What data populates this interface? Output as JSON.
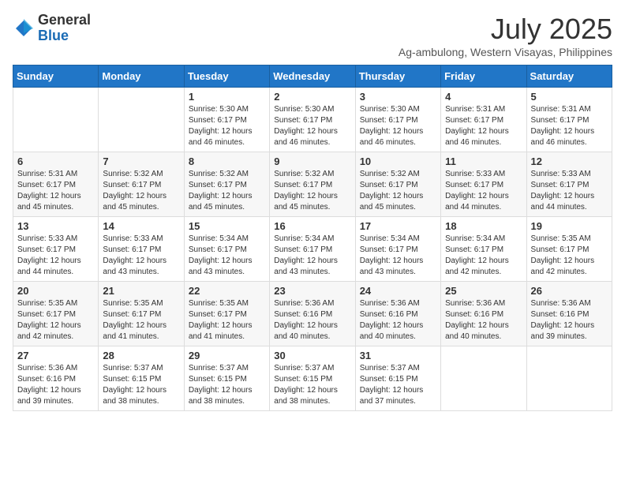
{
  "logo": {
    "general": "General",
    "blue": "Blue"
  },
  "title": "July 2025",
  "location": "Ag-ambulong, Western Visayas, Philippines",
  "weekdays": [
    "Sunday",
    "Monday",
    "Tuesday",
    "Wednesday",
    "Thursday",
    "Friday",
    "Saturday"
  ],
  "weeks": [
    [
      {
        "day": "",
        "info": ""
      },
      {
        "day": "",
        "info": ""
      },
      {
        "day": "1",
        "info": "Sunrise: 5:30 AM\nSunset: 6:17 PM\nDaylight: 12 hours and 46 minutes."
      },
      {
        "day": "2",
        "info": "Sunrise: 5:30 AM\nSunset: 6:17 PM\nDaylight: 12 hours and 46 minutes."
      },
      {
        "day": "3",
        "info": "Sunrise: 5:30 AM\nSunset: 6:17 PM\nDaylight: 12 hours and 46 minutes."
      },
      {
        "day": "4",
        "info": "Sunrise: 5:31 AM\nSunset: 6:17 PM\nDaylight: 12 hours and 46 minutes."
      },
      {
        "day": "5",
        "info": "Sunrise: 5:31 AM\nSunset: 6:17 PM\nDaylight: 12 hours and 46 minutes."
      }
    ],
    [
      {
        "day": "6",
        "info": "Sunrise: 5:31 AM\nSunset: 6:17 PM\nDaylight: 12 hours and 45 minutes."
      },
      {
        "day": "7",
        "info": "Sunrise: 5:32 AM\nSunset: 6:17 PM\nDaylight: 12 hours and 45 minutes."
      },
      {
        "day": "8",
        "info": "Sunrise: 5:32 AM\nSunset: 6:17 PM\nDaylight: 12 hours and 45 minutes."
      },
      {
        "day": "9",
        "info": "Sunrise: 5:32 AM\nSunset: 6:17 PM\nDaylight: 12 hours and 45 minutes."
      },
      {
        "day": "10",
        "info": "Sunrise: 5:32 AM\nSunset: 6:17 PM\nDaylight: 12 hours and 45 minutes."
      },
      {
        "day": "11",
        "info": "Sunrise: 5:33 AM\nSunset: 6:17 PM\nDaylight: 12 hours and 44 minutes."
      },
      {
        "day": "12",
        "info": "Sunrise: 5:33 AM\nSunset: 6:17 PM\nDaylight: 12 hours and 44 minutes."
      }
    ],
    [
      {
        "day": "13",
        "info": "Sunrise: 5:33 AM\nSunset: 6:17 PM\nDaylight: 12 hours and 44 minutes."
      },
      {
        "day": "14",
        "info": "Sunrise: 5:33 AM\nSunset: 6:17 PM\nDaylight: 12 hours and 43 minutes."
      },
      {
        "day": "15",
        "info": "Sunrise: 5:34 AM\nSunset: 6:17 PM\nDaylight: 12 hours and 43 minutes."
      },
      {
        "day": "16",
        "info": "Sunrise: 5:34 AM\nSunset: 6:17 PM\nDaylight: 12 hours and 43 minutes."
      },
      {
        "day": "17",
        "info": "Sunrise: 5:34 AM\nSunset: 6:17 PM\nDaylight: 12 hours and 43 minutes."
      },
      {
        "day": "18",
        "info": "Sunrise: 5:34 AM\nSunset: 6:17 PM\nDaylight: 12 hours and 42 minutes."
      },
      {
        "day": "19",
        "info": "Sunrise: 5:35 AM\nSunset: 6:17 PM\nDaylight: 12 hours and 42 minutes."
      }
    ],
    [
      {
        "day": "20",
        "info": "Sunrise: 5:35 AM\nSunset: 6:17 PM\nDaylight: 12 hours and 42 minutes."
      },
      {
        "day": "21",
        "info": "Sunrise: 5:35 AM\nSunset: 6:17 PM\nDaylight: 12 hours and 41 minutes."
      },
      {
        "day": "22",
        "info": "Sunrise: 5:35 AM\nSunset: 6:17 PM\nDaylight: 12 hours and 41 minutes."
      },
      {
        "day": "23",
        "info": "Sunrise: 5:36 AM\nSunset: 6:16 PM\nDaylight: 12 hours and 40 minutes."
      },
      {
        "day": "24",
        "info": "Sunrise: 5:36 AM\nSunset: 6:16 PM\nDaylight: 12 hours and 40 minutes."
      },
      {
        "day": "25",
        "info": "Sunrise: 5:36 AM\nSunset: 6:16 PM\nDaylight: 12 hours and 40 minutes."
      },
      {
        "day": "26",
        "info": "Sunrise: 5:36 AM\nSunset: 6:16 PM\nDaylight: 12 hours and 39 minutes."
      }
    ],
    [
      {
        "day": "27",
        "info": "Sunrise: 5:36 AM\nSunset: 6:16 PM\nDaylight: 12 hours and 39 minutes."
      },
      {
        "day": "28",
        "info": "Sunrise: 5:37 AM\nSunset: 6:15 PM\nDaylight: 12 hours and 38 minutes."
      },
      {
        "day": "29",
        "info": "Sunrise: 5:37 AM\nSunset: 6:15 PM\nDaylight: 12 hours and 38 minutes."
      },
      {
        "day": "30",
        "info": "Sunrise: 5:37 AM\nSunset: 6:15 PM\nDaylight: 12 hours and 38 minutes."
      },
      {
        "day": "31",
        "info": "Sunrise: 5:37 AM\nSunset: 6:15 PM\nDaylight: 12 hours and 37 minutes."
      },
      {
        "day": "",
        "info": ""
      },
      {
        "day": "",
        "info": ""
      }
    ]
  ]
}
